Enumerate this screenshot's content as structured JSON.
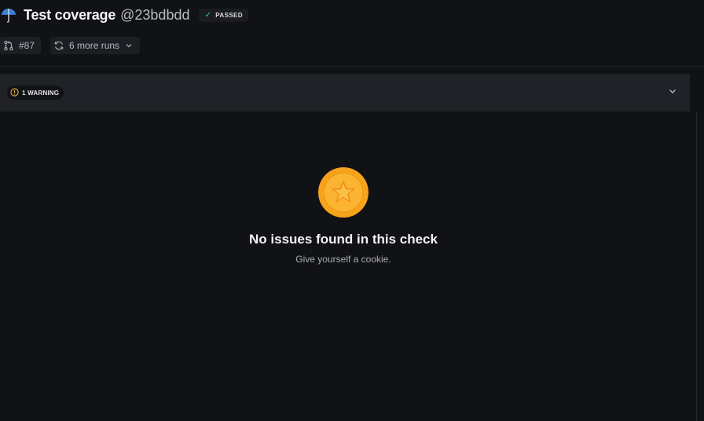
{
  "header": {
    "title": "Test coverage",
    "commit": "@23bdbdd",
    "status": "PASSED",
    "app_icon": "umbrella-icon"
  },
  "chips": {
    "pull_request": "#87",
    "runs": "6 more runs"
  },
  "warning": {
    "label": "1 WARNING"
  },
  "empty_state": {
    "title": "No issues found in this check",
    "subtitle": "Give yourself a cookie.",
    "icon": "star-medal-icon"
  },
  "colors": {
    "background": "#111215",
    "panel": "#202227",
    "success": "#3fcf8e",
    "medal": "#f7a21b"
  }
}
